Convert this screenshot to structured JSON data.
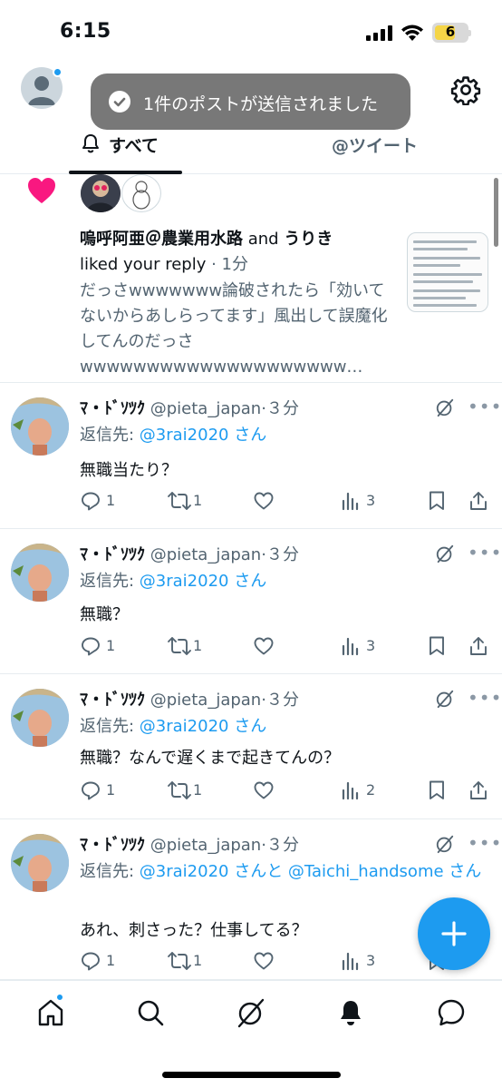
{
  "status_bar": {
    "time": "6:15",
    "battery": "6"
  },
  "toast": {
    "message": "1件のポストが送信されました"
  },
  "tabs": [
    {
      "label": "すべて",
      "active": true
    },
    {
      "label": "@ツイート",
      "active": false
    }
  ],
  "like_notification": {
    "user1": "嗚呼阿亜＠農業用水路",
    "and": " and ",
    "user2": "うりき",
    "action": "liked your reply",
    "time": " · 1分",
    "excerpt": "だっさwwwwwww論破されたら「効いてないからあしらってます」風出して誤魔化してんのだっさwwwwwwwwwwwwwwwwwwww…"
  },
  "tweets": [
    {
      "name": "ﾏ・ﾄﾞｿﾂｸ",
      "handle": "@pieta_japan",
      "time": "·３分",
      "reply_prefix": "返信先: ",
      "reply_to": "@3rai2020 さん",
      "text": "無職当たり？",
      "replies": "1",
      "retweets": "1",
      "views": "3"
    },
    {
      "name": "ﾏ・ﾄﾞｿﾂｸ",
      "handle": "@pieta_japan",
      "time": "·３分",
      "reply_prefix": "返信先: ",
      "reply_to": "@3rai2020 さん",
      "text": "無職？",
      "replies": "1",
      "retweets": "1",
      "views": "3"
    },
    {
      "name": "ﾏ・ﾄﾞｿﾂｸ",
      "handle": "@pieta_japan",
      "time": "·３分",
      "reply_prefix": "返信先: ",
      "reply_to": "@3rai2020 さん",
      "text": "無職？なんで遅くまで起きてんの？",
      "replies": "1",
      "retweets": "1",
      "views": "2"
    },
    {
      "name": "ﾏ・ﾄﾞｿﾂｸ",
      "handle": "@pieta_japan",
      "time": "·３分",
      "reply_prefix": "返信先: ",
      "reply_to": "@3rai2020 さんと @Taichi_handsome さん",
      "text": "あれ、刺さった？仕事してる？",
      "replies": "1",
      "retweets": "1",
      "views": "3"
    }
  ],
  "colors": {
    "accent": "#1d9bf0",
    "like": "#f91880",
    "muted": "#536471"
  },
  "icons": {
    "header": [
      "avatar-icon",
      "gear-icon",
      "bell-icon"
    ],
    "tabbar": [
      "home-icon",
      "search-icon",
      "grok-icon",
      "bell-icon",
      "messages-icon"
    ],
    "fab": "plus-icon"
  }
}
